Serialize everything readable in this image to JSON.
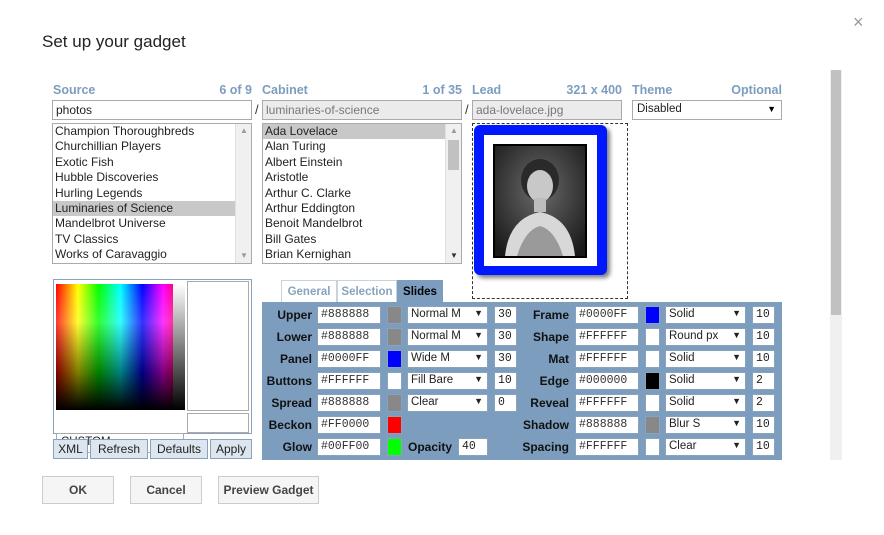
{
  "dialog": {
    "title": "Set up your gadget",
    "close_glyph": "×"
  },
  "source": {
    "label": "Source",
    "count": "6 of 9",
    "value": "photos",
    "items": [
      "Champion Thoroughbreds",
      "Churchillian Players",
      "Exotic Fish",
      "Hubble Discoveries",
      "Hurling Legends",
      "Luminaries of Science",
      "Mandelbrot Universe",
      "TV Classics",
      "Works of Caravaggio"
    ],
    "selected_index": 5
  },
  "cabinet": {
    "label": "Cabinet",
    "count": "1 of 35",
    "value": "luminaries-of-science",
    "items": [
      "Ada Lovelace",
      "Alan Turing",
      "Albert Einstein",
      "Aristotle",
      "Arthur C. Clarke",
      "Arthur Eddington",
      "Benoit Mandelbrot",
      "Bill Gates",
      "Brian Kernighan"
    ],
    "selected_index": 0
  },
  "lead": {
    "label": "Lead",
    "size": "321 x 400",
    "value": "ada-lovelace.jpg"
  },
  "theme": {
    "label": "Theme",
    "optional": "Optional",
    "value": "Disabled"
  },
  "separator": "/",
  "color_picker": {
    "preset": "CUSTOM",
    "buttons": [
      "XML",
      "Refresh",
      "Defaults",
      "Apply"
    ]
  },
  "tabs": [
    "General",
    "Selection",
    "Slides"
  ],
  "active_tab": 2,
  "slides_left": [
    {
      "label": "Upper",
      "hex": "#888888",
      "swatch": "#888888",
      "style": "Normal M",
      "num": "30"
    },
    {
      "label": "Lower",
      "hex": "#888888",
      "swatch": "#888888",
      "style": "Normal M",
      "num": "30"
    },
    {
      "label": "Panel",
      "hex": "#0000FF",
      "swatch": "#0000ff",
      "style": "Wide M",
      "num": "30"
    },
    {
      "label": "Buttons",
      "hex": "#FFFFFF",
      "swatch": "#ffffff",
      "style": "Fill Bare",
      "num": "10"
    },
    {
      "label": "Spread",
      "hex": "#888888",
      "swatch": "#888888",
      "style": "Clear",
      "num": "0"
    },
    {
      "label": "Beckon",
      "hex": "#FF0000",
      "swatch": "#ff0000"
    },
    {
      "label": "Glow",
      "hex": "#00FF00",
      "swatch": "#00ff00"
    }
  ],
  "opacity": {
    "label": "Opacity",
    "value": "40"
  },
  "slides_right": [
    {
      "label": "Frame",
      "hex": "#0000FF",
      "swatch": "#0000ff",
      "style": "Solid",
      "num": "10"
    },
    {
      "label": "Shape",
      "hex": "#FFFFFF",
      "swatch": "#ffffff",
      "style": "Round px",
      "num": "10"
    },
    {
      "label": "Mat",
      "hex": "#FFFFFF",
      "swatch": "#ffffff",
      "style": "Solid",
      "num": "10"
    },
    {
      "label": "Edge",
      "hex": "#000000",
      "swatch": "#000000",
      "style": "Solid",
      "num": "2"
    },
    {
      "label": "Reveal",
      "hex": "#FFFFFF",
      "swatch": "#ffffff",
      "style": "Solid",
      "num": "2"
    },
    {
      "label": "Shadow",
      "hex": "#888888",
      "swatch": "#888888",
      "style": "Blur S",
      "num": "10"
    },
    {
      "label": "Spacing",
      "hex": "#FFFFFF",
      "swatch": "#ffffff",
      "style": "Clear",
      "num": "10"
    }
  ],
  "footer": {
    "ok": "OK",
    "cancel": "Cancel",
    "preview": "Preview Gadget"
  },
  "colors": {
    "accent": "#7c9dbe",
    "frame_blue": "#0018ff",
    "button_bg": "#dde6ef"
  }
}
